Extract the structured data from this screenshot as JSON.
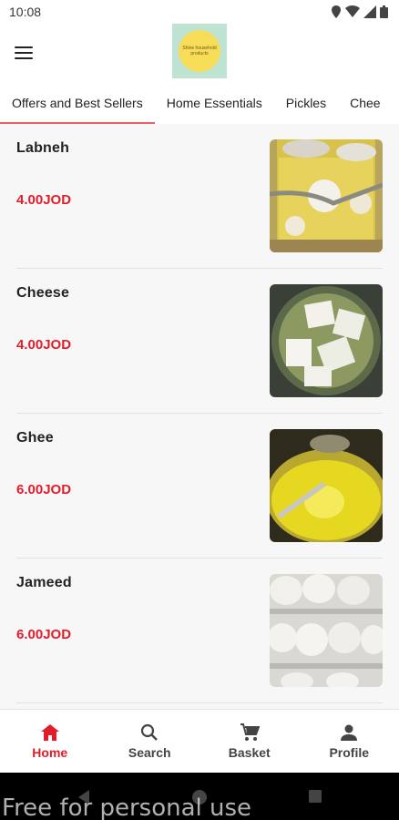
{
  "status": {
    "time": "10:08"
  },
  "logo": {
    "text": "Shine household products"
  },
  "tabs": [
    {
      "label": "Offers and Best Sellers",
      "active": true
    },
    {
      "label": "Home Essentials",
      "active": false
    },
    {
      "label": "Pickles",
      "active": false
    },
    {
      "label": "Chee",
      "active": false
    }
  ],
  "products": [
    {
      "name": "Labneh",
      "price": "4.00JOD",
      "image": "labneh-jar-photo"
    },
    {
      "name": "Cheese",
      "price": "4.00JOD",
      "image": "cheese-bowl-photo"
    },
    {
      "name": "Ghee",
      "price": "6.00JOD",
      "image": "ghee-tin-photo"
    },
    {
      "name": "Jameed",
      "price": "6.00JOD",
      "image": "jameed-tray-photo"
    }
  ],
  "bottom_nav": [
    {
      "label": "Home",
      "icon": "home-icon",
      "active": true
    },
    {
      "label": "Search",
      "icon": "search-icon",
      "active": false
    },
    {
      "label": "Basket",
      "icon": "cart-icon",
      "active": false
    },
    {
      "label": "Profile",
      "icon": "person-icon",
      "active": false
    }
  ],
  "watermark": "Free for personal use",
  "colors": {
    "price": "#e11d2b",
    "tab_indicator": "#e8606a",
    "logo_bg": "#bfe3d2",
    "logo_circle": "#f7dd57"
  }
}
